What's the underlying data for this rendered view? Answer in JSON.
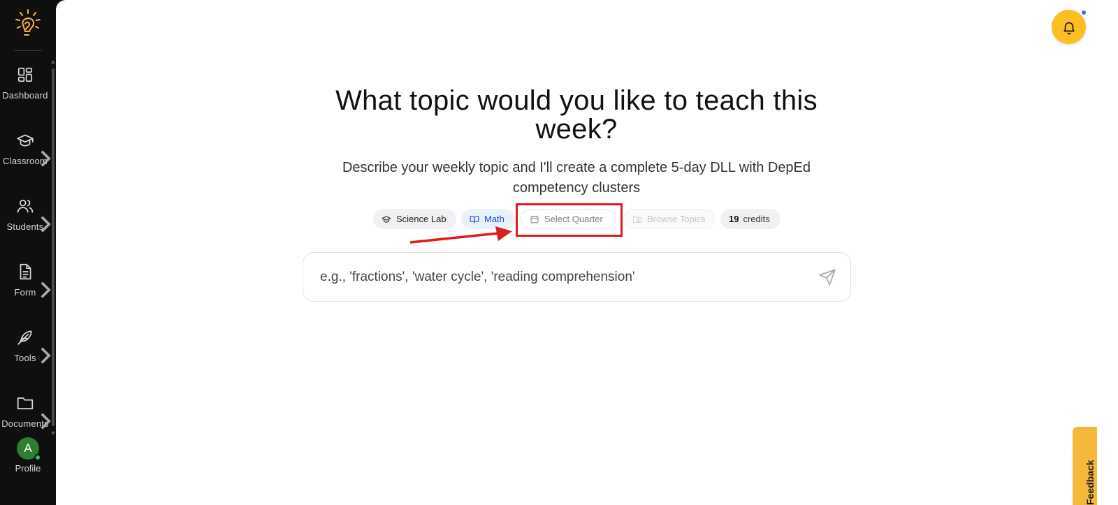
{
  "sidebar": {
    "items": [
      {
        "label": "Dashboard",
        "icon": "dashboard-grid-icon",
        "has_submenu": false
      },
      {
        "label": "Classroom",
        "icon": "graduation-cap-icon",
        "has_submenu": true
      },
      {
        "label": "Students",
        "icon": "users-icon",
        "has_submenu": true
      },
      {
        "label": "Form",
        "icon": "document-icon",
        "has_submenu": true
      },
      {
        "label": "Tools",
        "icon": "feather-icon",
        "has_submenu": true
      },
      {
        "label": "Documents",
        "icon": "folder-icon",
        "has_submenu": true
      }
    ],
    "profile": {
      "initial": "A",
      "label": "Profile",
      "status_color": "#22c55e"
    }
  },
  "main": {
    "headline": "What topic would you like to teach this week?",
    "subheadline": "Describe your weekly topic and I'll create a complete 5-day DLL with DepEd competency clusters",
    "chips": {
      "science": "Science Lab",
      "math": "Math",
      "quarter": "Select Quarter",
      "browse": "Browse Topics",
      "credits_count": "19",
      "credits_label": "credits"
    },
    "search": {
      "placeholder": "e.g., 'fractions', 'water cycle', 'reading comprehension'",
      "value": ""
    },
    "feedback_label": "Feedback"
  },
  "colors": {
    "accent_yellow": "#fbbf24",
    "math_blue": "#1d4ed8",
    "annotation_red": "#e01b1b",
    "sidebar_bg": "#0f0f10"
  }
}
